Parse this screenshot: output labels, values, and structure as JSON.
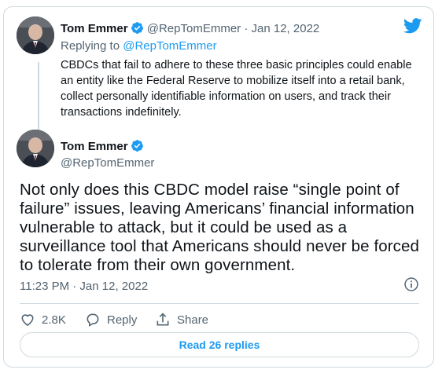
{
  "quoted_tweet": {
    "author_name": "Tom Emmer",
    "handle": "@RepTomEmmer",
    "separator": "·",
    "date": "Jan 12, 2022",
    "replying_prefix": "Replying to",
    "replying_to": "@RepTomEmmer",
    "text": "CBDCs that fail to adhere to these three basic principles could enable an entity like the Federal Reserve to mobilize itself into a retail bank, collect personally identifiable information on users, and track their transactions indefinitely."
  },
  "main_tweet": {
    "author_name": "Tom Emmer",
    "handle": "@RepTomEmmer",
    "text": "Not only does this CBDC model raise “single point of failure” issues, leaving Americans’ financial information vulnerable to attack, but it could be used as a surveillance tool that Americans should never be forced to tolerate from their own government.",
    "timestamp": "11:23 PM · Jan 12, 2022"
  },
  "actions": {
    "like_count": "2.8K",
    "reply_label": "Reply",
    "share_label": "Share"
  },
  "read_replies_label": "Read 26 replies",
  "icons": {
    "logo": "twitter-bird-icon",
    "verified": "verified-badge-icon",
    "info": "info-icon",
    "like": "heart-icon",
    "reply": "reply-bubble-icon",
    "share": "share-icon"
  },
  "colors": {
    "accent": "#1d9bf0",
    "muted_text": "#536471",
    "border": "#cfd9de",
    "text": "#0f1419"
  }
}
